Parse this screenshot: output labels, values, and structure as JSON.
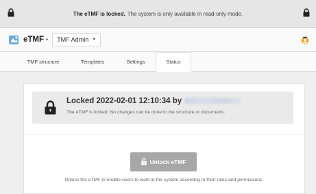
{
  "banner": {
    "locked_bold": "The eTMF is locked.",
    "message": "The system is only available in read-only mode."
  },
  "appbar": {
    "app_name": "eTMF",
    "separator": "•",
    "env_select": "TMF Admin"
  },
  "tabs": [
    {
      "label": "TMF structure"
    },
    {
      "label": "Templates"
    },
    {
      "label": "Settings"
    },
    {
      "label": "Status",
      "active": true
    }
  ],
  "status": {
    "title": "Locked 2022-02-01 12:10:34 by",
    "description": "The eTMF is locked. No changes can be done to the structure or documents.",
    "unlock_button": "Unlock eTMF",
    "help_text": "Unlock the eTMF to enable users to work in the system according to their roles and permissions."
  },
  "colors": {
    "button_disabled": "#a7a7a7",
    "user_icon": "#f5a023"
  },
  "icons": [
    "lock-icon",
    "app-logo-icon",
    "chevron-down-icon",
    "user-icon",
    "unlock-icon"
  ]
}
